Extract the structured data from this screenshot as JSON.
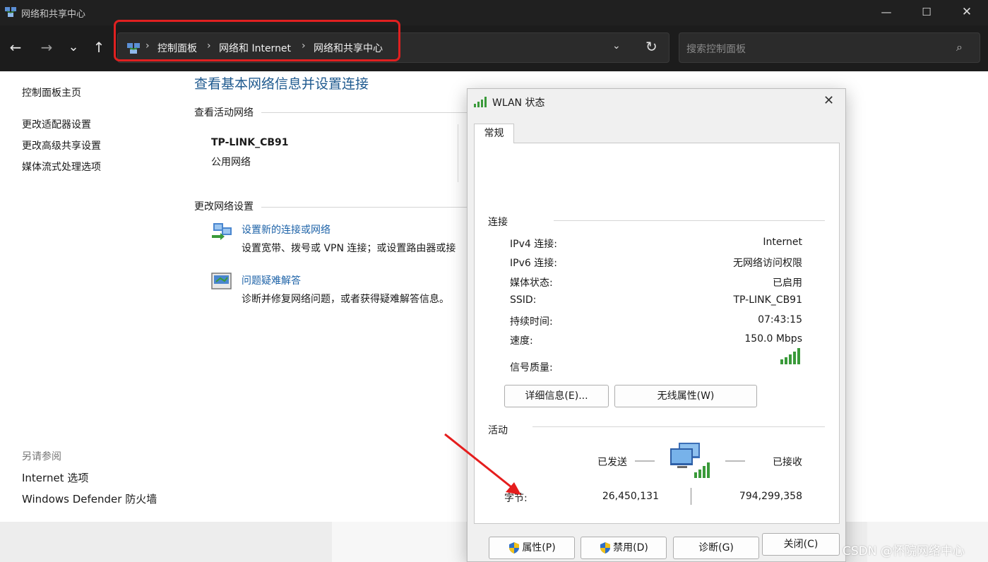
{
  "window": {
    "title": "网络和共享中心",
    "minimize_glyph": "—",
    "maximize_glyph": "☐",
    "close_glyph": "✕"
  },
  "nav": {
    "back": "←",
    "forward": "→",
    "recent": "⌄",
    "up": "↑",
    "dropdown": "⌄",
    "refresh": "↻"
  },
  "address": {
    "crumbs": [
      "控制面板",
      "网络和 Internet",
      "网络和共享中心"
    ],
    "separator": "›"
  },
  "search": {
    "placeholder": "搜索控制面板",
    "icon": "⌕"
  },
  "sidebar": {
    "home": "控制面板主页",
    "items": [
      "更改适配器设置",
      "更改高级共享设置",
      "媒体流式处理选项"
    ],
    "see_also_title": "另请参阅",
    "see_also": [
      "Internet 选项",
      "Windows Defender 防火墙"
    ]
  },
  "main": {
    "title": "查看基本网络信息并设置连接",
    "active_networks_title": "查看活动网络",
    "network_name": "TP-LINK_CB91",
    "network_type": "公用网络",
    "change_settings_title": "更改网络设置",
    "tasks": [
      {
        "title": "设置新的连接或网络",
        "desc": "设置宽带、拨号或 VPN 连接；或设置路由器或接"
      },
      {
        "title": "问题疑难解答",
        "desc": "诊断并修复网络问题，或者获得疑难解答信息。"
      }
    ]
  },
  "dialog": {
    "title": "WLAN 状态",
    "close": "✕",
    "tab": "常规",
    "connection_title": "连接",
    "fields": [
      {
        "label": "IPv4 连接:",
        "value": "Internet"
      },
      {
        "label": "IPv6 连接:",
        "value": "无网络访问权限"
      },
      {
        "label": "媒体状态:",
        "value": "已启用"
      },
      {
        "label": "SSID:",
        "value": "TP-LINK_CB91"
      },
      {
        "label": "持续时间:",
        "value": "07:43:15"
      },
      {
        "label": "速度:",
        "value": "150.0 Mbps"
      }
    ],
    "signal_label": "信号质量:",
    "signal_bars": 5,
    "details_button": "详细信息(E)...",
    "wireless_button": "无线属性(W)",
    "activity_title": "活动",
    "sent_label": "已发送",
    "received_label": "已接收",
    "bytes_label": "字节:",
    "bytes_sent": "26,450,131",
    "bytes_received": "794,299,358",
    "properties_button": "属性(P)",
    "disable_button": "禁用(D)",
    "diagnose_button": "诊断(G)",
    "close_button": "关闭(C)"
  },
  "watermark": "CSDN @怀院网络中心",
  "colors": {
    "accent": "#1e63a8",
    "title_blue": "#1f5a8f",
    "highlight_red": "#e02020",
    "titlebar": "#202020",
    "signal_green": "#3a9a3a"
  }
}
